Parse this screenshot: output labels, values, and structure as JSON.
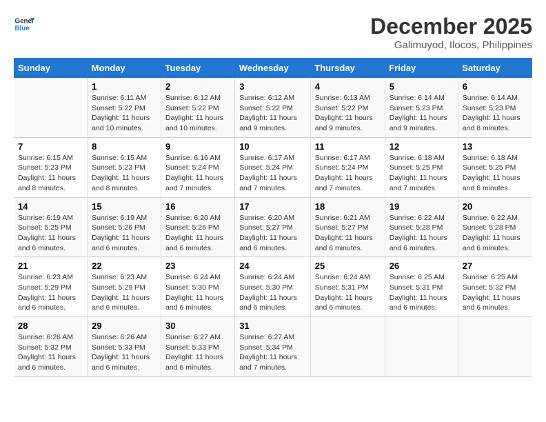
{
  "header": {
    "logo_line1": "General",
    "logo_line2": "Blue",
    "title": "December 2025",
    "subtitle": "Galimuyod, Ilocos, Philippines"
  },
  "days_of_week": [
    "Sunday",
    "Monday",
    "Tuesday",
    "Wednesday",
    "Thursday",
    "Friday",
    "Saturday"
  ],
  "weeks": [
    [
      {
        "day": "",
        "sunrise": "",
        "sunset": "",
        "daylight": ""
      },
      {
        "day": "1",
        "sunrise": "Sunrise: 6:11 AM",
        "sunset": "Sunset: 5:22 PM",
        "daylight": "Daylight: 11 hours and 10 minutes."
      },
      {
        "day": "2",
        "sunrise": "Sunrise: 6:12 AM",
        "sunset": "Sunset: 5:22 PM",
        "daylight": "Daylight: 11 hours and 10 minutes."
      },
      {
        "day": "3",
        "sunrise": "Sunrise: 6:12 AM",
        "sunset": "Sunset: 5:22 PM",
        "daylight": "Daylight: 11 hours and 9 minutes."
      },
      {
        "day": "4",
        "sunrise": "Sunrise: 6:13 AM",
        "sunset": "Sunset: 5:22 PM",
        "daylight": "Daylight: 11 hours and 9 minutes."
      },
      {
        "day": "5",
        "sunrise": "Sunrise: 6:14 AM",
        "sunset": "Sunset: 5:23 PM",
        "daylight": "Daylight: 11 hours and 9 minutes."
      },
      {
        "day": "6",
        "sunrise": "Sunrise: 6:14 AM",
        "sunset": "Sunset: 5:23 PM",
        "daylight": "Daylight: 11 hours and 8 minutes."
      }
    ],
    [
      {
        "day": "7",
        "sunrise": "Sunrise: 6:15 AM",
        "sunset": "Sunset: 5:23 PM",
        "daylight": "Daylight: 11 hours and 8 minutes."
      },
      {
        "day": "8",
        "sunrise": "Sunrise: 6:15 AM",
        "sunset": "Sunset: 5:23 PM",
        "daylight": "Daylight: 11 hours and 8 minutes."
      },
      {
        "day": "9",
        "sunrise": "Sunrise: 6:16 AM",
        "sunset": "Sunset: 5:24 PM",
        "daylight": "Daylight: 11 hours and 7 minutes."
      },
      {
        "day": "10",
        "sunrise": "Sunrise: 6:17 AM",
        "sunset": "Sunset: 5:24 PM",
        "daylight": "Daylight: 11 hours and 7 minutes."
      },
      {
        "day": "11",
        "sunrise": "Sunrise: 6:17 AM",
        "sunset": "Sunset: 5:24 PM",
        "daylight": "Daylight: 11 hours and 7 minutes."
      },
      {
        "day": "12",
        "sunrise": "Sunrise: 6:18 AM",
        "sunset": "Sunset: 5:25 PM",
        "daylight": "Daylight: 11 hours and 7 minutes."
      },
      {
        "day": "13",
        "sunrise": "Sunrise: 6:18 AM",
        "sunset": "Sunset: 5:25 PM",
        "daylight": "Daylight: 11 hours and 6 minutes."
      }
    ],
    [
      {
        "day": "14",
        "sunrise": "Sunrise: 6:19 AM",
        "sunset": "Sunset: 5:25 PM",
        "daylight": "Daylight: 11 hours and 6 minutes."
      },
      {
        "day": "15",
        "sunrise": "Sunrise: 6:19 AM",
        "sunset": "Sunset: 5:26 PM",
        "daylight": "Daylight: 11 hours and 6 minutes."
      },
      {
        "day": "16",
        "sunrise": "Sunrise: 6:20 AM",
        "sunset": "Sunset: 5:26 PM",
        "daylight": "Daylight: 11 hours and 6 minutes."
      },
      {
        "day": "17",
        "sunrise": "Sunrise: 6:20 AM",
        "sunset": "Sunset: 5:27 PM",
        "daylight": "Daylight: 11 hours and 6 minutes."
      },
      {
        "day": "18",
        "sunrise": "Sunrise: 6:21 AM",
        "sunset": "Sunset: 5:27 PM",
        "daylight": "Daylight: 11 hours and 6 minutes."
      },
      {
        "day": "19",
        "sunrise": "Sunrise: 6:22 AM",
        "sunset": "Sunset: 5:28 PM",
        "daylight": "Daylight: 11 hours and 6 minutes."
      },
      {
        "day": "20",
        "sunrise": "Sunrise: 6:22 AM",
        "sunset": "Sunset: 5:28 PM",
        "daylight": "Daylight: 11 hours and 6 minutes."
      }
    ],
    [
      {
        "day": "21",
        "sunrise": "Sunrise: 6:23 AM",
        "sunset": "Sunset: 5:29 PM",
        "daylight": "Daylight: 11 hours and 6 minutes."
      },
      {
        "day": "22",
        "sunrise": "Sunrise: 6:23 AM",
        "sunset": "Sunset: 5:29 PM",
        "daylight": "Daylight: 11 hours and 6 minutes."
      },
      {
        "day": "23",
        "sunrise": "Sunrise: 6:24 AM",
        "sunset": "Sunset: 5:30 PM",
        "daylight": "Daylight: 11 hours and 6 minutes."
      },
      {
        "day": "24",
        "sunrise": "Sunrise: 6:24 AM",
        "sunset": "Sunset: 5:30 PM",
        "daylight": "Daylight: 11 hours and 6 minutes."
      },
      {
        "day": "25",
        "sunrise": "Sunrise: 6:24 AM",
        "sunset": "Sunset: 5:31 PM",
        "daylight": "Daylight: 11 hours and 6 minutes."
      },
      {
        "day": "26",
        "sunrise": "Sunrise: 6:25 AM",
        "sunset": "Sunset: 5:31 PM",
        "daylight": "Daylight: 11 hours and 6 minutes."
      },
      {
        "day": "27",
        "sunrise": "Sunrise: 6:25 AM",
        "sunset": "Sunset: 5:32 PM",
        "daylight": "Daylight: 11 hours and 6 minutes."
      }
    ],
    [
      {
        "day": "28",
        "sunrise": "Sunrise: 6:26 AM",
        "sunset": "Sunset: 5:32 PM",
        "daylight": "Daylight: 11 hours and 6 minutes."
      },
      {
        "day": "29",
        "sunrise": "Sunrise: 6:26 AM",
        "sunset": "Sunset: 5:33 PM",
        "daylight": "Daylight: 11 hours and 6 minutes."
      },
      {
        "day": "30",
        "sunrise": "Sunrise: 6:27 AM",
        "sunset": "Sunset: 5:33 PM",
        "daylight": "Daylight: 11 hours and 6 minutes."
      },
      {
        "day": "31",
        "sunrise": "Sunrise: 6:27 AM",
        "sunset": "Sunset: 5:34 PM",
        "daylight": "Daylight: 11 hours and 7 minutes."
      },
      {
        "day": "",
        "sunrise": "",
        "sunset": "",
        "daylight": ""
      },
      {
        "day": "",
        "sunrise": "",
        "sunset": "",
        "daylight": ""
      },
      {
        "day": "",
        "sunrise": "",
        "sunset": "",
        "daylight": ""
      }
    ]
  ]
}
